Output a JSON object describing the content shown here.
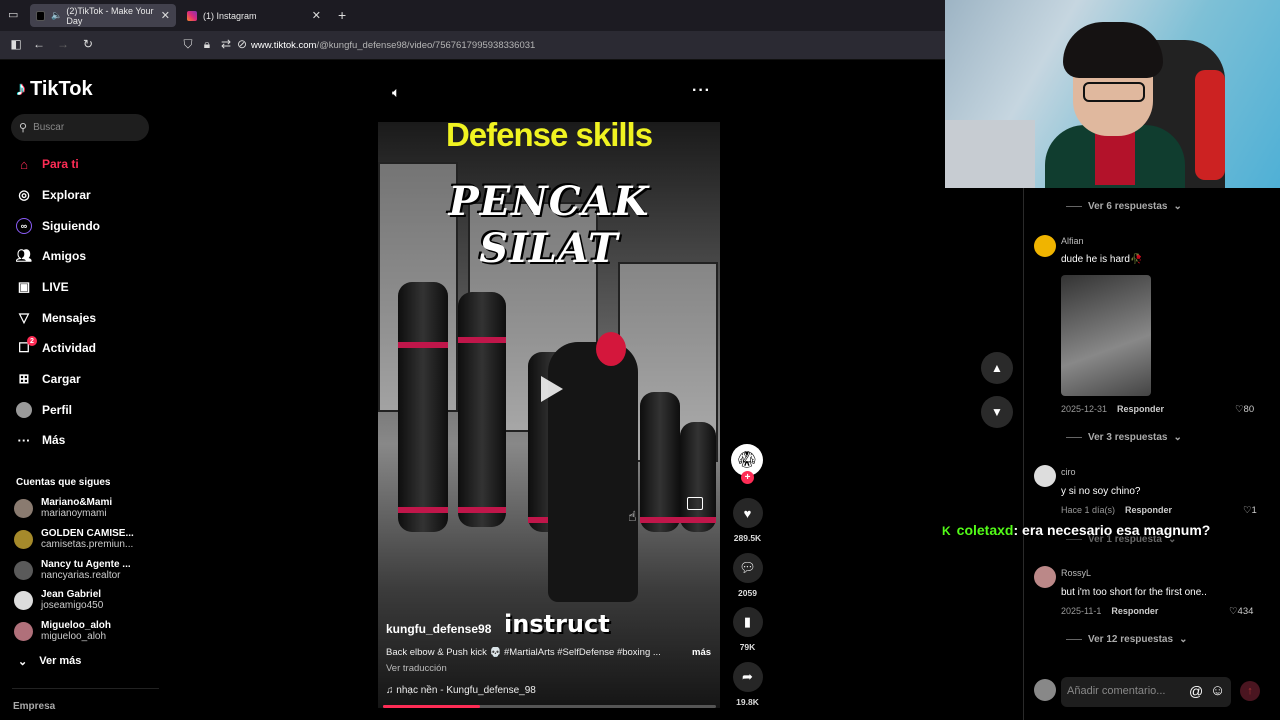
{
  "browser": {
    "tabs": [
      {
        "label": "(2)TikTok - Make Your Day",
        "close": "✕"
      },
      {
        "label": "(1) Instagram",
        "close": "✕"
      }
    ],
    "new_tab": "+",
    "url_domain": "www.tiktok.com",
    "url_path": "/@kungfu_defense98/video/7567617995938336031"
  },
  "sidebar": {
    "logo": "TikTok",
    "search_placeholder": "Buscar",
    "nav": [
      {
        "label": "Para ti",
        "icon": "home-icon"
      },
      {
        "label": "Explorar",
        "icon": "compass-icon"
      },
      {
        "label": "Siguiendo",
        "icon": "following-icon"
      },
      {
        "label": "Amigos",
        "icon": "friends-icon"
      },
      {
        "label": "LIVE",
        "icon": "live-icon"
      },
      {
        "label": "Mensajes",
        "icon": "messages-icon"
      },
      {
        "label": "Actividad",
        "icon": "activity-icon",
        "badge": "2"
      },
      {
        "label": "Cargar",
        "icon": "upload-icon"
      },
      {
        "label": "Perfil",
        "icon": "profile-icon"
      },
      {
        "label": "Más",
        "icon": "more-icon"
      }
    ],
    "following_title": "Cuentas que sigues",
    "following": [
      {
        "name": "Mariano&Mami",
        "handle": "marianoymami"
      },
      {
        "name": "GOLDEN CAMISE...",
        "handle": "camisetas.premiun..."
      },
      {
        "name": "Nancy tu Agente ...",
        "handle": "nancyarias.realtor"
      },
      {
        "name": "Jean Gabriel",
        "handle": "joseamigo450"
      },
      {
        "name": "Migueloo_aloh",
        "handle": "migueloo_aloh"
      }
    ],
    "ver_mas": "Ver más",
    "empresa": "Empresa"
  },
  "video": {
    "overlay_title": "Defense skills",
    "overlay_subtitle": "PENCAK SILAT",
    "caption_word": "instruct",
    "author": "kungfu_defense98",
    "description": "Back elbow & Push kick 💀 #MartialArts #SelfDefense #boxing ...",
    "more": "más",
    "translate": "Ver traducción",
    "music": "♫  nhạc nền - Kungfu_defense_98",
    "progress": 0.29
  },
  "actions": {
    "likes": "289.5K",
    "comments": "2059",
    "saves": "79K",
    "shares": "19.8K"
  },
  "comments": {
    "ver_top": "Ver 6 respuestas",
    "items": [
      {
        "user": "Alfian",
        "text": "dude he is hard🥀",
        "date": "2025-12-31",
        "reply": "Responder",
        "likes": "80",
        "ver": "Ver 3 respuestas"
      },
      {
        "user": "ciro",
        "text": "y si no soy chino?",
        "date": "Hace 1 día(s)",
        "reply": "Responder",
        "likes": "1",
        "ver": "Ver 1 respuesta"
      },
      {
        "user": "RossyL",
        "text": "but i'm too short for the first one..",
        "date": "2025-11-1",
        "reply": "Responder",
        "likes": "434",
        "ver": "Ver 12 respuestas"
      }
    ],
    "input_placeholder": "Añadir comentario..."
  },
  "chat_overlay": {
    "user": "coletaxd",
    "message": ": era necesario esa magnum?"
  }
}
